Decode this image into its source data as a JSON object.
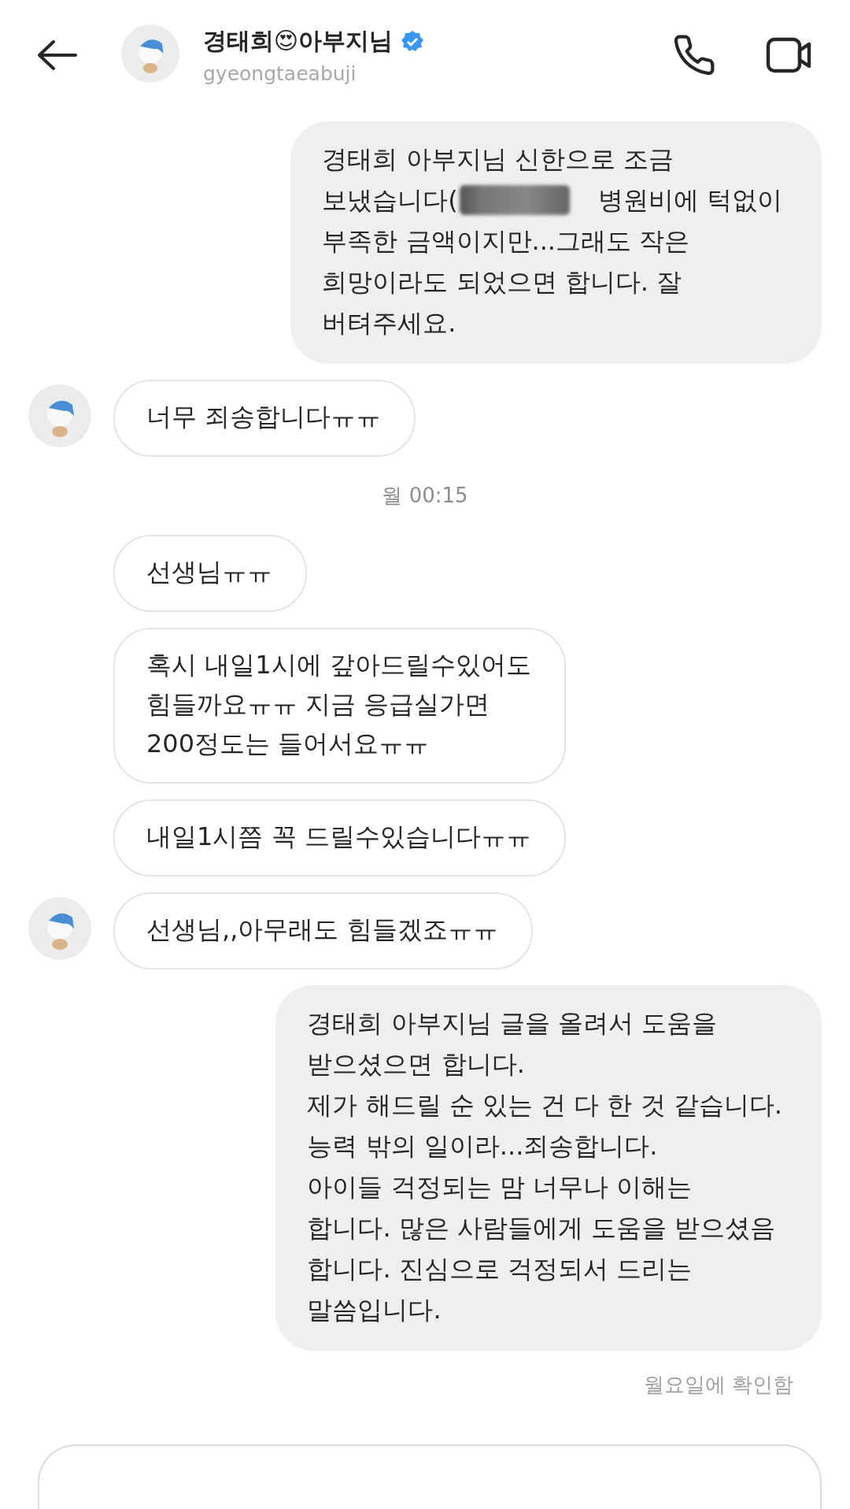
{
  "header": {
    "name": "경태희😍아부지님",
    "verified": true,
    "username": "gyeongtaeabuji"
  },
  "messages": [
    {
      "kind": "sent",
      "lines": [
        "경태희 아부지님 신한으로 조금",
        {
          "kind": "redacted",
          "before": "보냈습니다(",
          "after": "병원비에 턱없이"
        },
        "부족한 금액이지만...그래도 작은",
        "희망이라도 되었으면 합니다. 잘",
        "버텨주세요."
      ]
    },
    {
      "kind": "received",
      "avatar": true,
      "lines": [
        "너무 죄송합니다ㅠㅠ"
      ]
    },
    {
      "kind": "time",
      "text": "월 00:15"
    },
    {
      "kind": "received",
      "avatar": false,
      "lines": [
        "선생님ㅠㅠ"
      ]
    },
    {
      "kind": "received",
      "avatar": false,
      "lines": [
        "혹시 내일1시에 갚아드릴수있어도",
        "힘들까요ㅠㅠ 지금 응급실가면",
        "200정도는 들어서요ㅠㅠ"
      ]
    },
    {
      "kind": "received",
      "avatar": false,
      "lines": [
        "내일1시쯤 꼭 드릴수있습니다ㅠㅠ"
      ]
    },
    {
      "kind": "received",
      "avatar": true,
      "lines": [
        "선생님,,아무래도 힘들겠죠ㅠㅠ"
      ]
    },
    {
      "kind": "sent",
      "lines": [
        "경태희 아부지님 글을 올려서 도움을",
        "받으셨으면 합니다.",
        "제가 해드릴 순 있는 건 다 한 것 같습니다.",
        "능력 밖의 일이라...죄송합니다.",
        "아이들 걱정되는 맘 너무나 이해는",
        "합니다. 많은 사람들에게 도움을 받으셨음",
        "합니다. 진심으로 걱정되서 드리는",
        "말씀입니다."
      ]
    }
  ],
  "read_receipt": "월요일에 확인함"
}
